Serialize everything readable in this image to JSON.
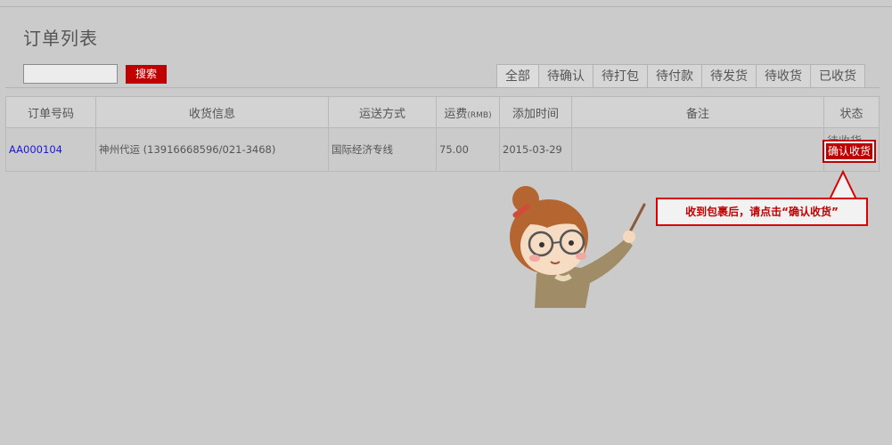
{
  "page": {
    "title": "订单列表"
  },
  "search": {
    "value": "",
    "placeholder": "",
    "button_label": "搜索"
  },
  "tabs": [
    "全部",
    "待确认",
    "待打包",
    "待付款",
    "待发货",
    "待收货",
    "已收货"
  ],
  "table": {
    "headers": {
      "order_no": "订单号码",
      "receiver": "收货信息",
      "shipping": "运送方式",
      "freight": "运费",
      "freight_unit": "(RMB)",
      "added": "添加时间",
      "remark": "备注",
      "status": "状态"
    },
    "rows": [
      {
        "order_no": "AA000104",
        "receiver": "神州代运 (13916668596/021-3468)",
        "shipping": "国际经济专线",
        "freight": "75.00",
        "added": "2015-03-29",
        "remark": "",
        "status": "待收货",
        "action": "确认收货"
      }
    ]
  },
  "callout": {
    "text": "收到包裹后，请点击“确认收货”"
  },
  "colors": {
    "accent": "#c00000",
    "link": "#1a1acc",
    "background": "#cbcbcb"
  }
}
